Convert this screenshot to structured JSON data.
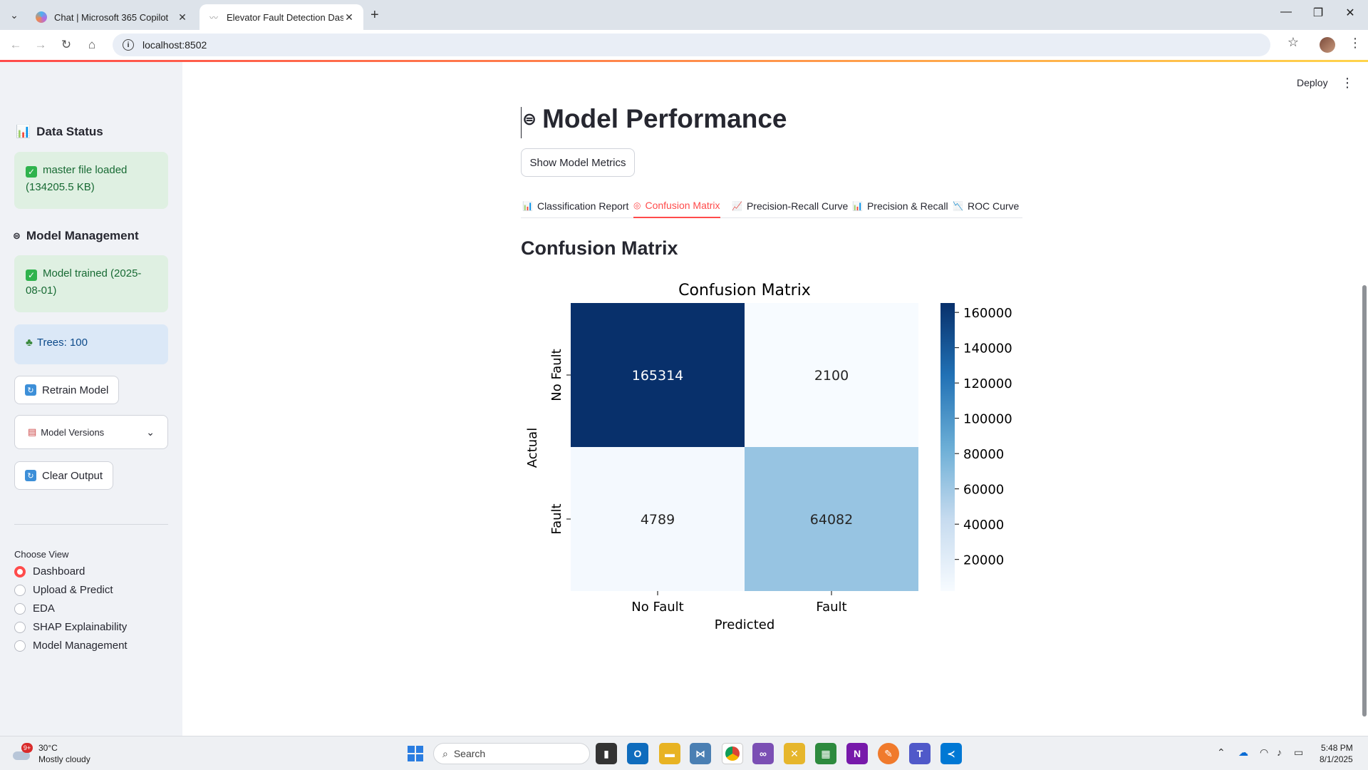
{
  "browser": {
    "tabs": [
      {
        "title": "Chat | Microsoft 365 Copilot",
        "active": false
      },
      {
        "title": "Elevator Fault Detection Dashbo",
        "active": true
      }
    ],
    "url": "localhost:8502"
  },
  "sidebar": {
    "data_status": {
      "heading": "Data Status",
      "message": "master file loaded (134205.5 KB)"
    },
    "model_management": {
      "heading": "Model Management",
      "trained_message": "Model trained (2025-08-01)",
      "trees_message": "Trees: 100",
      "retrain_label": "Retrain Model",
      "versions_label": "Model Versions",
      "clear_label": "Clear Output"
    },
    "choose_view": {
      "label": "Choose View",
      "options": [
        "Dashboard",
        "Upload & Predict",
        "EDA",
        "SHAP Explainability",
        "Model Management"
      ],
      "selected": "Dashboard"
    }
  },
  "header": {
    "deploy_label": "Deploy"
  },
  "main": {
    "title": "Model Performance",
    "show_metrics_label": "Show Model Metrics",
    "tabs": [
      {
        "label": "Classification Report",
        "icon": "bar-chart-icon"
      },
      {
        "label": "Confusion Matrix",
        "icon": "target-icon"
      },
      {
        "label": "Precision-Recall Curve",
        "icon": "line-chart-icon"
      },
      {
        "label": "Precision & Recall",
        "icon": "bar-chart-icon"
      },
      {
        "label": "ROC Curve",
        "icon": "trend-down-icon"
      }
    ],
    "active_tab": "Confusion Matrix",
    "section_title": "Confusion Matrix"
  },
  "chart_data": {
    "type": "heatmap",
    "title": "Confusion Matrix",
    "xlabel": "Predicted",
    "ylabel": "Actual",
    "x_categories": [
      "No Fault",
      "Fault"
    ],
    "y_categories": [
      "No Fault",
      "Fault"
    ],
    "values": [
      [
        165314,
        2100
      ],
      [
        4789,
        64082
      ]
    ],
    "colormap": "Blues",
    "colorbar_ticks": [
      20000,
      40000,
      60000,
      80000,
      100000,
      120000,
      140000,
      160000
    ],
    "vmin": 2100,
    "vmax": 165314
  },
  "taskbar": {
    "weather_temp": "30°C",
    "weather_desc": "Mostly cloudy",
    "weather_badge": "9+",
    "search_placeholder": "Search",
    "time": "5:48 PM",
    "date": "8/1/2025"
  }
}
